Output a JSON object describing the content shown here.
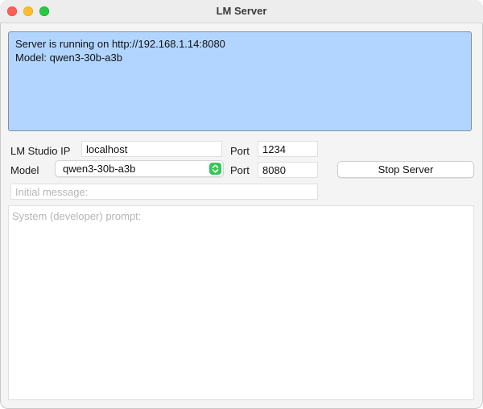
{
  "window": {
    "title": "LM Server"
  },
  "status": {
    "lines": [
      "Server is running on http://192.168.1.14:8080",
      "Model: qwen3-30b-a3b"
    ],
    "background_color": "#b2d5ff"
  },
  "lmstudio": {
    "ip_label": "LM Studio IP",
    "ip_value": "localhost",
    "port_label": "Port",
    "port_value": "1234"
  },
  "model": {
    "label": "Model",
    "selected": "qwen3-30b-a3b",
    "port_label": "Port",
    "port_value": "8080"
  },
  "actions": {
    "stop_server_label": "Stop Server"
  },
  "initial_message": {
    "placeholder": "Initial message:"
  },
  "system_prompt": {
    "placeholder": "System (developer) prompt:"
  },
  "icons": {
    "close": "close-window-icon",
    "minimize": "minimize-window-icon",
    "maximize": "maximize-window-icon",
    "select": "chevron-up-down-icon"
  },
  "colors": {
    "close": "#ff5f57",
    "minimize": "#febc2e",
    "maximize": "#28c840",
    "select_accent": "#34c759"
  }
}
